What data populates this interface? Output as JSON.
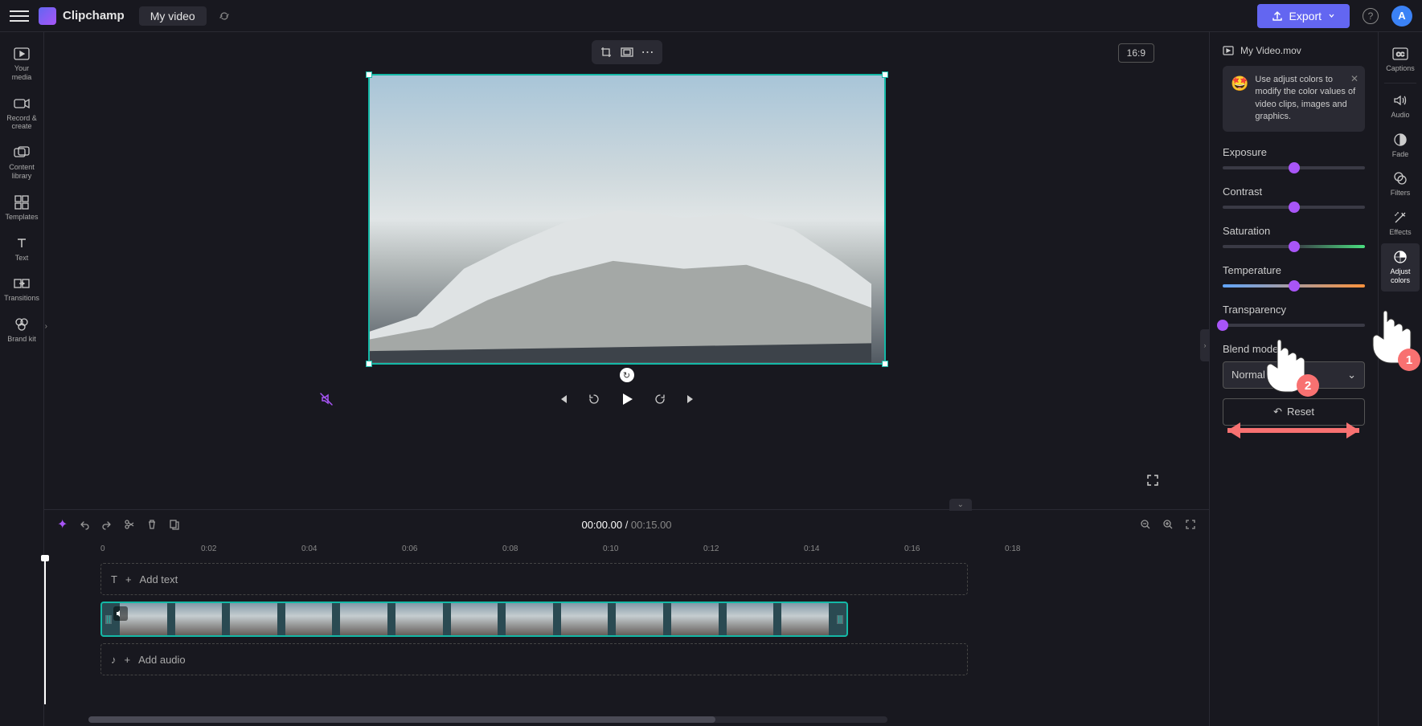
{
  "header": {
    "app_name": "Clipchamp",
    "video_title": "My video",
    "export_label": "Export",
    "avatar_letter": "A"
  },
  "left_sidebar": {
    "items": [
      {
        "label": "Your media"
      },
      {
        "label": "Record & create"
      },
      {
        "label": "Content library"
      },
      {
        "label": "Templates"
      },
      {
        "label": "Text"
      },
      {
        "label": "Transitions"
      },
      {
        "label": "Brand kit"
      }
    ]
  },
  "preview": {
    "aspect_ratio": "16:9"
  },
  "timeline": {
    "current_time": "00:00.00",
    "total_time": "00:15.00",
    "marks": [
      "0",
      "0:02",
      "0:04",
      "0:06",
      "0:08",
      "0:10",
      "0:12",
      "0:14",
      "0:16",
      "0:18"
    ],
    "add_text_label": "Add text",
    "add_audio_label": "Add audio"
  },
  "right_panel": {
    "file_name": "My Video.mov",
    "tip_text": "Use adjust colors to modify the color values of video clips, images and graphics.",
    "sliders": {
      "exposure": {
        "label": "Exposure",
        "value": 50
      },
      "contrast": {
        "label": "Contrast",
        "value": 50
      },
      "saturation": {
        "label": "Saturation",
        "value": 50
      },
      "temperature": {
        "label": "Temperature",
        "value": 50
      },
      "transparency": {
        "label": "Transparency",
        "value": 0
      }
    },
    "blend_mode_label": "Blend mode",
    "blend_mode_value": "Normal",
    "reset_label": "Reset"
  },
  "far_right_sidebar": {
    "items": [
      {
        "label": "Captions"
      },
      {
        "label": "Audio"
      },
      {
        "label": "Fade"
      },
      {
        "label": "Filters"
      },
      {
        "label": "Effects"
      },
      {
        "label": "Adjust colors"
      }
    ]
  },
  "overlays": {
    "badge1": "1",
    "badge2": "2"
  }
}
